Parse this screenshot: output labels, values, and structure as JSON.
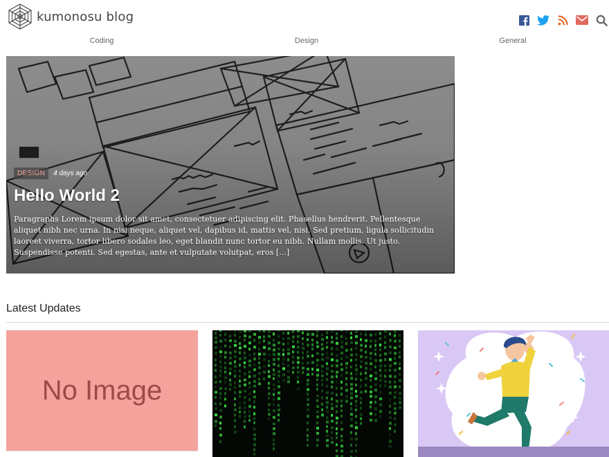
{
  "site": {
    "name": "kumonosu blog"
  },
  "social": {
    "icons": [
      "facebook-icon",
      "twitter-icon",
      "rss-icon",
      "mail-icon",
      "search-icon"
    ],
    "colors": {
      "facebook": "#3b5998",
      "twitter": "#1da1f2",
      "rss": "#e2641f",
      "mail": "#e06a5f",
      "search": "#666666"
    }
  },
  "nav": {
    "items": [
      "Coding",
      "Design",
      "General"
    ]
  },
  "featured": {
    "category": "DESIGN",
    "time_ago": "4 days ago",
    "title": "Hello World 2",
    "excerpt": "Paragraphs Lorem ipsum dolor sit amet, consectetuer adipiscing elit. Phasellus hendrerit. Pellentesque aliquet nibh nec urna. In nisi neque, aliquet vel, dapibus id, mattis vel, nisi. Sed pretium, ligula sollicitudin laoreet viverra, tortor libero sodales leo, eget blandit nunc tortor eu nibh. Nullam mollis. Ut justo. Suspendisse potenti. Sed egestas, ante et vulputate volutpat, eros [...]"
  },
  "latest": {
    "heading": "Latest Updates",
    "cards": [
      {
        "placeholder": "No Image"
      }
    ]
  },
  "colors": {
    "accent": "#f4a39c",
    "badge_text": "#f2a29c"
  }
}
